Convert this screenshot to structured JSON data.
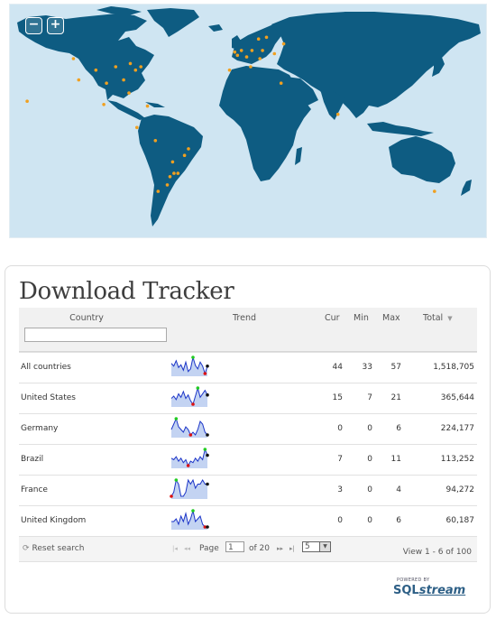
{
  "map": {
    "zoom_out_label": "−",
    "zoom_in_label": "+",
    "ocean_color": "#cfe5f2",
    "land_color": "#0e5c82",
    "marker_color": "#f0a020",
    "markers": [
      {
        "lon": -122,
        "lat": 47
      },
      {
        "lon": -118,
        "lat": 34
      },
      {
        "lon": -105,
        "lat": 40
      },
      {
        "lon": -97,
        "lat": 32
      },
      {
        "lon": -90,
        "lat": 42
      },
      {
        "lon": -84,
        "lat": 34
      },
      {
        "lon": -80,
        "lat": 26
      },
      {
        "lon": -75,
        "lat": 40
      },
      {
        "lon": -71,
        "lat": 42
      },
      {
        "lon": -79,
        "lat": 44
      },
      {
        "lon": -157,
        "lat": 21
      },
      {
        "lon": -99,
        "lat": 19
      },
      {
        "lon": -74,
        "lat": 5
      },
      {
        "lon": -60,
        "lat": -3
      },
      {
        "lon": -47,
        "lat": -16
      },
      {
        "lon": -43,
        "lat": -23
      },
      {
        "lon": -46,
        "lat": -23
      },
      {
        "lon": -49,
        "lat": -25
      },
      {
        "lon": -51,
        "lat": -30
      },
      {
        "lon": -38,
        "lat": -12
      },
      {
        "lon": -35,
        "lat": -8
      },
      {
        "lon": -58,
        "lat": -34
      },
      {
        "lon": -66,
        "lat": 18
      },
      {
        "lon": 0,
        "lat": 51
      },
      {
        "lon": 2,
        "lat": 49
      },
      {
        "lon": 13,
        "lat": 52
      },
      {
        "lon": 9,
        "lat": 48
      },
      {
        "lon": -4,
        "lat": 40
      },
      {
        "lon": 12,
        "lat": 42
      },
      {
        "lon": 5,
        "lat": 52
      },
      {
        "lon": 18,
        "lat": 59
      },
      {
        "lon": 24,
        "lat": 60
      },
      {
        "lon": 21,
        "lat": 52
      },
      {
        "lon": 37,
        "lat": 56
      },
      {
        "lon": 30,
        "lat": 50
      },
      {
        "lon": 19,
        "lat": 47
      },
      {
        "lon": 35,
        "lat": 32
      },
      {
        "lon": 78,
        "lat": 13
      },
      {
        "lon": 151,
        "lat": -34
      }
    ]
  },
  "tracker": {
    "title": "Download Tracker",
    "columns": {
      "country": "Country",
      "trend": "Trend",
      "cur": "Cur",
      "min": "Min",
      "max": "Max",
      "total": "Total",
      "total_sort": "▼"
    },
    "filter_value": "",
    "rows": [
      {
        "country": "All countries",
        "cur": "44",
        "min": "33",
        "max": "57",
        "total": "1,518,705",
        "trend": [
          48,
          44,
          52,
          42,
          46,
          38,
          50,
          36,
          40,
          57,
          45,
          40,
          50,
          44,
          33,
          44
        ]
      },
      {
        "country": "United States",
        "cur": "15",
        "min": "7",
        "max": "21",
        "total": "365,644",
        "trend": [
          12,
          14,
          11,
          16,
          13,
          18,
          12,
          15,
          10,
          7,
          14,
          21,
          13,
          16,
          19,
          15
        ]
      },
      {
        "country": "Germany",
        "cur": "0",
        "min": "0",
        "max": "6",
        "total": "224,177",
        "trend": [
          2,
          4,
          6,
          3,
          2,
          1,
          3,
          2,
          0,
          1,
          0,
          2,
          5,
          4,
          1,
          0
        ]
      },
      {
        "country": "Brazil",
        "cur": "7",
        "min": "0",
        "max": "11",
        "total": "113,252",
        "trend": [
          5,
          4,
          6,
          3,
          5,
          2,
          4,
          0,
          3,
          2,
          5,
          3,
          6,
          4,
          11,
          7
        ]
      },
      {
        "country": "France",
        "cur": "3",
        "min": "0",
        "max": "4",
        "total": "94,272",
        "trend": [
          0,
          1,
          4,
          3,
          0,
          0,
          1,
          4,
          3,
          4,
          2,
          3,
          3,
          4,
          3,
          3
        ]
      },
      {
        "country": "United Kingdom",
        "cur": "0",
        "min": "0",
        "max": "6",
        "total": "60,187",
        "trend": [
          2,
          2,
          3,
          1,
          4,
          2,
          5,
          1,
          3,
          6,
          2,
          3,
          4,
          1,
          0,
          0
        ]
      }
    ],
    "spark_colors": {
      "line": "#1c35c8",
      "fill": "#c3d3f2",
      "min": "#dd1111",
      "max": "#22cc22",
      "last": "#111111"
    },
    "pager": {
      "reset_label": "Reset search",
      "first": "|◂",
      "prev": "◂◂",
      "next": "▸▸",
      "last": "▸|",
      "page_label": "Page",
      "page_value": "1",
      "of_label": "of 20",
      "per_page": "5",
      "view_info": "View 1 - 6 of 100"
    },
    "powered_by": "POWERED BY",
    "brand_sql": "SQL",
    "brand_stream": "stream"
  }
}
